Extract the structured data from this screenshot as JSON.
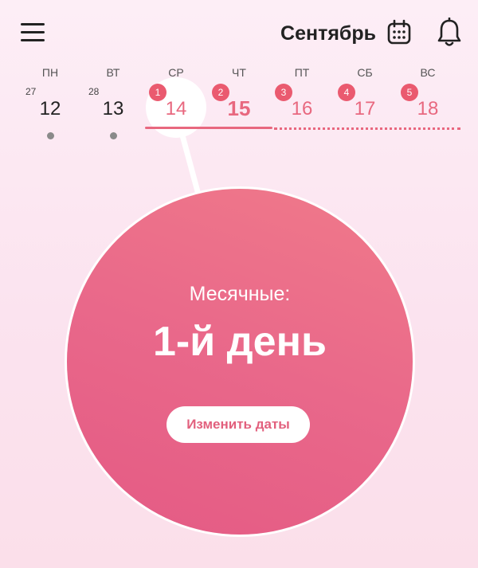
{
  "header": {
    "month": "Сентябрь",
    "menu_icon": "hamburger-menu-icon",
    "calendar_icon": "calendar-icon",
    "notifications_icon": "bell-icon"
  },
  "week": {
    "days": [
      {
        "dow": "ПН",
        "number": "12",
        "prev_number": "27",
        "state": "past"
      },
      {
        "dow": "ВТ",
        "number": "13",
        "prev_number": "28",
        "state": "past"
      },
      {
        "dow": "СР",
        "number": "14",
        "badge": "1",
        "state": "period-selected"
      },
      {
        "dow": "ЧТ",
        "number": "15",
        "badge": "2",
        "state": "period-today"
      },
      {
        "dow": "ПТ",
        "number": "16",
        "badge": "3",
        "state": "period-predicted"
      },
      {
        "dow": "СБ",
        "number": "17",
        "badge": "4",
        "state": "period-predicted"
      },
      {
        "dow": "ВС",
        "number": "18",
        "badge": "5",
        "state": "period-predicted"
      }
    ]
  },
  "circle": {
    "label": "Месячные:",
    "day_text": "1-й день",
    "button_label": "Изменить даты"
  },
  "colors": {
    "accent": "#e8687f",
    "circle": "#e9688a",
    "background": "#fdeef6"
  }
}
